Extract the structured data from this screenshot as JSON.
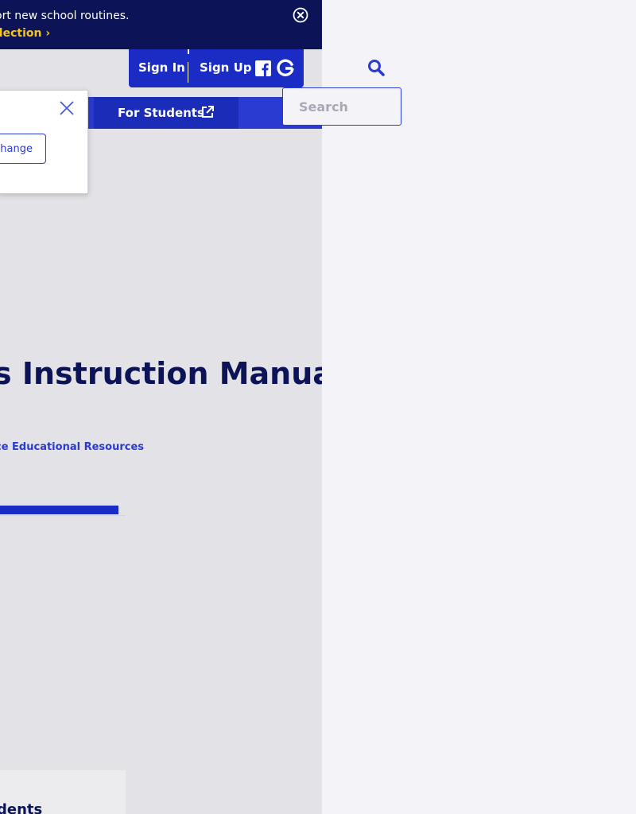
{
  "promo": {
    "text": "ort new school routines.",
    "link_label": "llection",
    "link_chevron": "›",
    "close_icon": "close-circle-icon"
  },
  "header": {
    "sign_in_label": "Sign In",
    "sign_up_label": "Sign Up",
    "social_icons": [
      "facebook-icon",
      "google-icon"
    ]
  },
  "search": {
    "placeholder": "Search",
    "icon": "search-icon"
  },
  "nav": {
    "students_label": "For Students",
    "students_icon": "external-link-icon"
  },
  "popover": {
    "button_label": "change",
    "close_icon": "close-icon"
  },
  "main": {
    "title": "s Instruction Manual  |",
    "breadcrumb": "ce Educational Resources",
    "progress_fraction": 0.94,
    "card_title": "dents"
  },
  "colors": {
    "navy": "#0c1357",
    "brand_blue": "#1a2cc4",
    "accent_yellow": "#f5c518"
  }
}
